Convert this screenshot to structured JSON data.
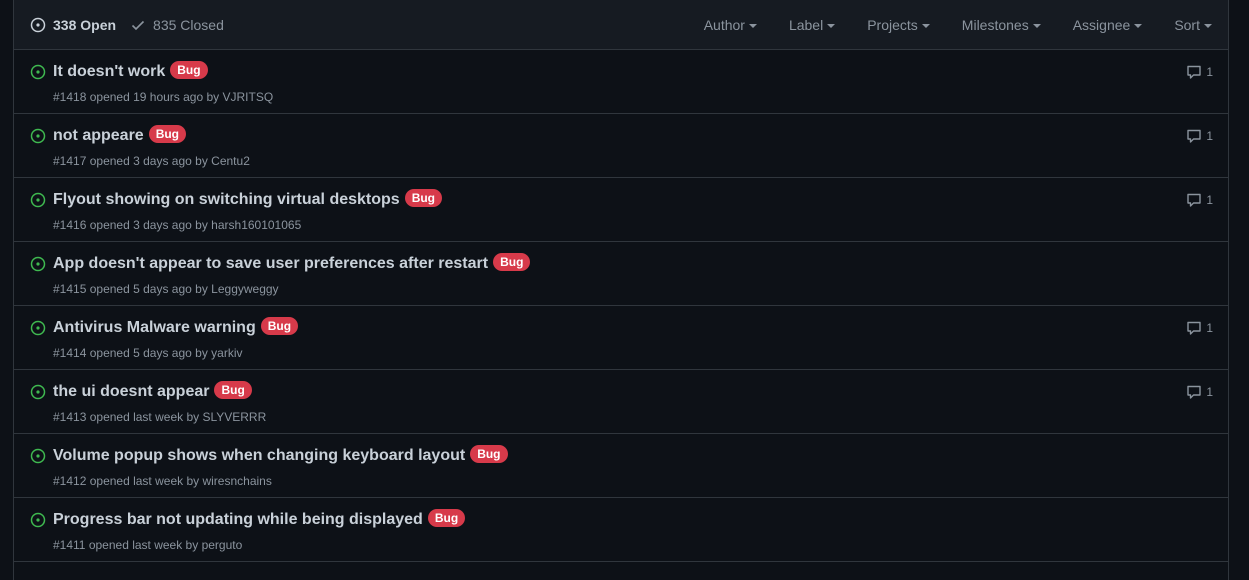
{
  "header": {
    "open_label": "338 Open",
    "closed_label": "835 Closed",
    "filters": [
      "Author",
      "Label",
      "Projects",
      "Milestones",
      "Assignee",
      "Sort"
    ]
  },
  "colors": {
    "open_green": "#3fb950",
    "bug_label": "#d73a4a",
    "background": "#0d1117",
    "header_bg": "#161b22",
    "border": "#30363d"
  },
  "issues": [
    {
      "title": "It doesn't work",
      "label": "Bug",
      "number": "#1418",
      "opened": "opened 19 hours ago by",
      "author": "VJRITSQ",
      "comments": "1"
    },
    {
      "title": "not appeare",
      "label": "Bug",
      "number": "#1417",
      "opened": "opened 3 days ago by",
      "author": "Centu2",
      "comments": "1"
    },
    {
      "title": "Flyout showing on switching virtual desktops",
      "label": "Bug",
      "number": "#1416",
      "opened": "opened 3 days ago by",
      "author": "harsh160101065",
      "comments": "1"
    },
    {
      "title": "App doesn't appear to save user preferences after restart",
      "label": "Bug",
      "number": "#1415",
      "opened": "opened 5 days ago by",
      "author": "Leggyweggy",
      "comments": ""
    },
    {
      "title": "Antivirus Malware warning",
      "label": "Bug",
      "number": "#1414",
      "opened": "opened 5 days ago by",
      "author": "yarkiv",
      "comments": "1"
    },
    {
      "title": "the ui doesnt appear",
      "label": "Bug",
      "number": "#1413",
      "opened": "opened last week by",
      "author": "SLYVERRR",
      "comments": "1"
    },
    {
      "title": "Volume popup shows when changing keyboard layout",
      "label": "Bug",
      "number": "#1412",
      "opened": "opened last week by",
      "author": "wiresnchains",
      "comments": ""
    },
    {
      "title": "Progress bar not updating while being displayed",
      "label": "Bug",
      "number": "#1411",
      "opened": "opened last week by",
      "author": "perguto",
      "comments": ""
    }
  ]
}
